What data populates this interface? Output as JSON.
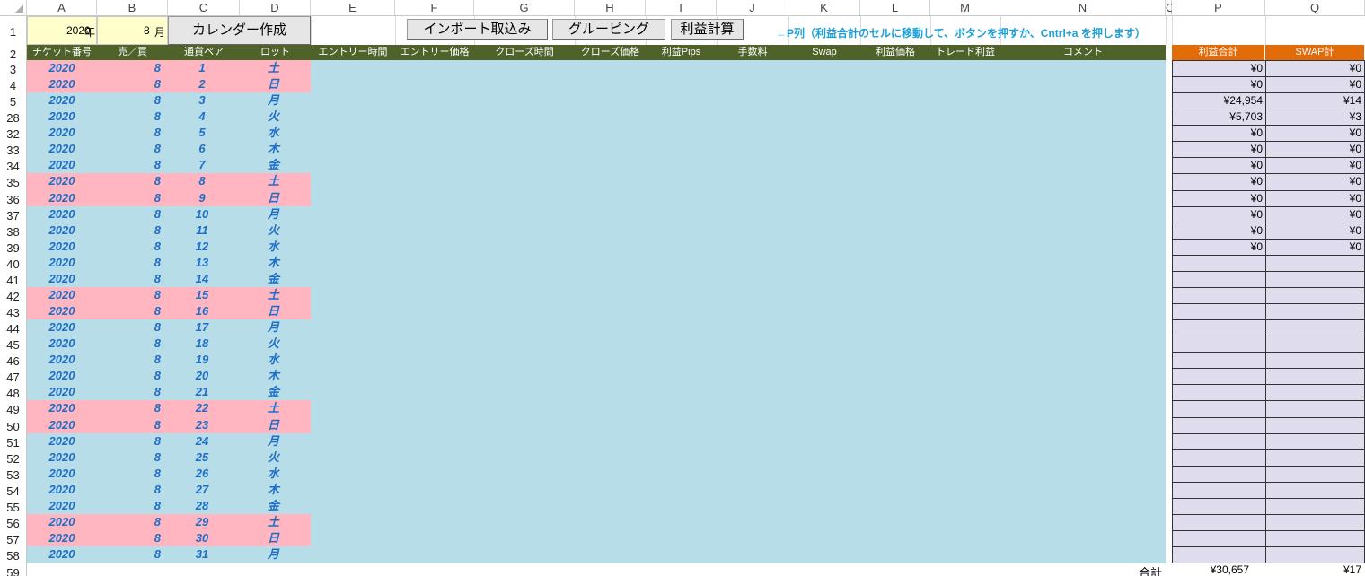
{
  "columns": [
    "A",
    "B",
    "C",
    "D",
    "E",
    "F",
    "G",
    "H",
    "I",
    "J",
    "K",
    "L",
    "M",
    "N",
    "O",
    "P",
    "Q"
  ],
  "row1": {
    "year_value": "2020",
    "year_unit": "年",
    "month_value": "8",
    "month_unit": "月",
    "calendar_button": "カレンダー作成",
    "import_button": "インポート取込み",
    "grouping_button": "グルーピング",
    "profit_button": "利益計算",
    "instruction": "←P列（利益合計のセルに移動して、ボタンを押すか、Cntrl+a を押します）"
  },
  "headers": [
    "チケット番号",
    "売／買",
    "通貨ペア",
    "ロット",
    "エントリー時間",
    "エントリー価格",
    "クローズ時間",
    "クローズ価格",
    "利益Pips",
    "手数料",
    "Swap",
    "利益価格",
    "トレード利益",
    "コメント"
  ],
  "summary_headers": [
    "利益合計",
    "SWAP計"
  ],
  "rows": [
    {
      "num": "3",
      "year": "2020",
      "month": "8",
      "day": "1",
      "weekday": "土",
      "weekend": true,
      "profit": "¥0",
      "swap": "¥0"
    },
    {
      "num": "4",
      "year": "2020",
      "month": "8",
      "day": "2",
      "weekday": "日",
      "weekend": true,
      "profit": "¥0",
      "swap": "¥0"
    },
    {
      "num": "5",
      "year": "2020",
      "month": "8",
      "day": "3",
      "weekday": "月",
      "weekend": false,
      "profit": "¥24,954",
      "swap": "¥14"
    },
    {
      "num": "28",
      "year": "2020",
      "month": "8",
      "day": "4",
      "weekday": "火",
      "weekend": false,
      "profit": "¥5,703",
      "swap": "¥3"
    },
    {
      "num": "32",
      "year": "2020",
      "month": "8",
      "day": "5",
      "weekday": "水",
      "weekend": false,
      "profit": "¥0",
      "swap": "¥0"
    },
    {
      "num": "33",
      "year": "2020",
      "month": "8",
      "day": "6",
      "weekday": "木",
      "weekend": false,
      "profit": "¥0",
      "swap": "¥0"
    },
    {
      "num": "34",
      "year": "2020",
      "month": "8",
      "day": "7",
      "weekday": "金",
      "weekend": false,
      "profit": "¥0",
      "swap": "¥0"
    },
    {
      "num": "35",
      "year": "2020",
      "month": "8",
      "day": "8",
      "weekday": "土",
      "weekend": true,
      "profit": "¥0",
      "swap": "¥0"
    },
    {
      "num": "36",
      "year": "2020",
      "month": "8",
      "day": "9",
      "weekday": "日",
      "weekend": true,
      "profit": "¥0",
      "swap": "¥0"
    },
    {
      "num": "37",
      "year": "2020",
      "month": "8",
      "day": "10",
      "weekday": "月",
      "weekend": false,
      "profit": "¥0",
      "swap": "¥0"
    },
    {
      "num": "38",
      "year": "2020",
      "month": "8",
      "day": "11",
      "weekday": "火",
      "weekend": false,
      "profit": "¥0",
      "swap": "¥0"
    },
    {
      "num": "39",
      "year": "2020",
      "month": "8",
      "day": "12",
      "weekday": "水",
      "weekend": false,
      "profit": "¥0",
      "swap": "¥0"
    },
    {
      "num": "40",
      "year": "2020",
      "month": "8",
      "day": "13",
      "weekday": "木",
      "weekend": false,
      "profit": "",
      "swap": ""
    },
    {
      "num": "41",
      "year": "2020",
      "month": "8",
      "day": "14",
      "weekday": "金",
      "weekend": false,
      "profit": "",
      "swap": ""
    },
    {
      "num": "42",
      "year": "2020",
      "month": "8",
      "day": "15",
      "weekday": "土",
      "weekend": true,
      "profit": "",
      "swap": ""
    },
    {
      "num": "43",
      "year": "2020",
      "month": "8",
      "day": "16",
      "weekday": "日",
      "weekend": true,
      "profit": "",
      "swap": ""
    },
    {
      "num": "44",
      "year": "2020",
      "month": "8",
      "day": "17",
      "weekday": "月",
      "weekend": false,
      "profit": "",
      "swap": ""
    },
    {
      "num": "45",
      "year": "2020",
      "month": "8",
      "day": "18",
      "weekday": "火",
      "weekend": false,
      "profit": "",
      "swap": ""
    },
    {
      "num": "46",
      "year": "2020",
      "month": "8",
      "day": "19",
      "weekday": "水",
      "weekend": false,
      "profit": "",
      "swap": ""
    },
    {
      "num": "47",
      "year": "2020",
      "month": "8",
      "day": "20",
      "weekday": "木",
      "weekend": false,
      "profit": "",
      "swap": ""
    },
    {
      "num": "48",
      "year": "2020",
      "month": "8",
      "day": "21",
      "weekday": "金",
      "weekend": false,
      "profit": "",
      "swap": ""
    },
    {
      "num": "49",
      "year": "2020",
      "month": "8",
      "day": "22",
      "weekday": "土",
      "weekend": true,
      "profit": "",
      "swap": ""
    },
    {
      "num": "50",
      "year": "2020",
      "month": "8",
      "day": "23",
      "weekday": "日",
      "weekend": true,
      "profit": "",
      "swap": ""
    },
    {
      "num": "51",
      "year": "2020",
      "month": "8",
      "day": "24",
      "weekday": "月",
      "weekend": false,
      "profit": "",
      "swap": ""
    },
    {
      "num": "52",
      "year": "2020",
      "month": "8",
      "day": "25",
      "weekday": "火",
      "weekend": false,
      "profit": "",
      "swap": ""
    },
    {
      "num": "53",
      "year": "2020",
      "month": "8",
      "day": "26",
      "weekday": "水",
      "weekend": false,
      "profit": "",
      "swap": ""
    },
    {
      "num": "54",
      "year": "2020",
      "month": "8",
      "day": "27",
      "weekday": "木",
      "weekend": false,
      "profit": "",
      "swap": ""
    },
    {
      "num": "55",
      "year": "2020",
      "month": "8",
      "day": "28",
      "weekday": "金",
      "weekend": false,
      "profit": "",
      "swap": ""
    },
    {
      "num": "56",
      "year": "2020",
      "month": "8",
      "day": "29",
      "weekday": "土",
      "weekend": true,
      "profit": "",
      "swap": ""
    },
    {
      "num": "57",
      "year": "2020",
      "month": "8",
      "day": "30",
      "weekday": "日",
      "weekend": true,
      "profit": "",
      "swap": ""
    },
    {
      "num": "58",
      "year": "2020",
      "month": "8",
      "day": "31",
      "weekday": "月",
      "weekend": false,
      "profit": "",
      "swap": ""
    }
  ],
  "total_row": {
    "num": "59",
    "label": "合計",
    "profit": "¥30,657",
    "swap": "¥17"
  },
  "colors": {
    "header_green": "#4e6229",
    "header_orange": "#e26b0a",
    "weekday_bg": "#b7dde8",
    "weekend_bg": "#ffb6c1",
    "year_cell_bg": "#ffffcc",
    "summary_bg": "#dfdced",
    "data_text": "#1e6ec8"
  }
}
